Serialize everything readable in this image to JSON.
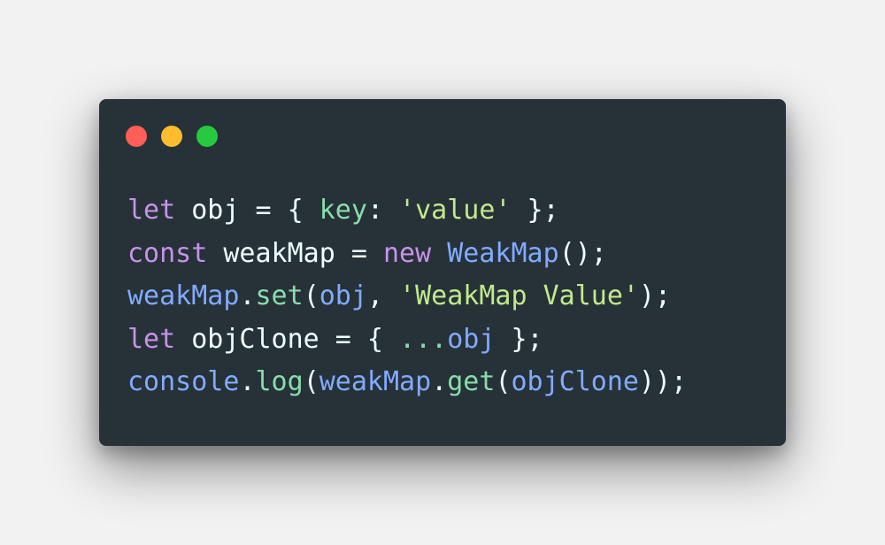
{
  "window": {
    "background_color": "#263238",
    "controls": [
      {
        "name": "close",
        "color": "#ff5f56"
      },
      {
        "name": "minimize",
        "color": "#ffbd2e"
      },
      {
        "name": "maximize",
        "color": "#27c93f"
      }
    ]
  },
  "palette": {
    "keyword": "#c792ea",
    "plain": "#eeffff",
    "property": "#89ddaa",
    "string": "#c3e88d",
    "function": "#82aaff",
    "method": "#89ddaa"
  },
  "code": {
    "lines": [
      [
        {
          "t": "let",
          "c": "keyword"
        },
        {
          "t": " obj = { ",
          "c": "plain"
        },
        {
          "t": "key",
          "c": "property"
        },
        {
          "t": ": ",
          "c": "plain"
        },
        {
          "t": "'value'",
          "c": "string"
        },
        {
          "t": " };",
          "c": "plain"
        }
      ],
      [
        {
          "t": "const",
          "c": "keyword"
        },
        {
          "t": " weakMap = ",
          "c": "plain"
        },
        {
          "t": "new",
          "c": "keyword"
        },
        {
          "t": " ",
          "c": "plain"
        },
        {
          "t": "WeakMap",
          "c": "function"
        },
        {
          "t": "();",
          "c": "plain"
        }
      ],
      [
        {
          "t": "weakMap",
          "c": "function"
        },
        {
          "t": ".",
          "c": "plain"
        },
        {
          "t": "set",
          "c": "method"
        },
        {
          "t": "(",
          "c": "plain"
        },
        {
          "t": "obj",
          "c": "function"
        },
        {
          "t": ", ",
          "c": "plain"
        },
        {
          "t": "'WeakMap Value'",
          "c": "string"
        },
        {
          "t": ");",
          "c": "plain"
        }
      ],
      [
        {
          "t": "let",
          "c": "keyword"
        },
        {
          "t": " objClone = { ",
          "c": "plain"
        },
        {
          "t": "...",
          "c": "property"
        },
        {
          "t": "obj",
          "c": "function"
        },
        {
          "t": " };",
          "c": "plain"
        }
      ],
      [
        {
          "t": "console",
          "c": "function"
        },
        {
          "t": ".",
          "c": "plain"
        },
        {
          "t": "log",
          "c": "method"
        },
        {
          "t": "(",
          "c": "plain"
        },
        {
          "t": "weakMap",
          "c": "function"
        },
        {
          "t": ".",
          "c": "plain"
        },
        {
          "t": "get",
          "c": "method"
        },
        {
          "t": "(",
          "c": "plain"
        },
        {
          "t": "objClone",
          "c": "function"
        },
        {
          "t": "));",
          "c": "plain"
        }
      ]
    ]
  }
}
